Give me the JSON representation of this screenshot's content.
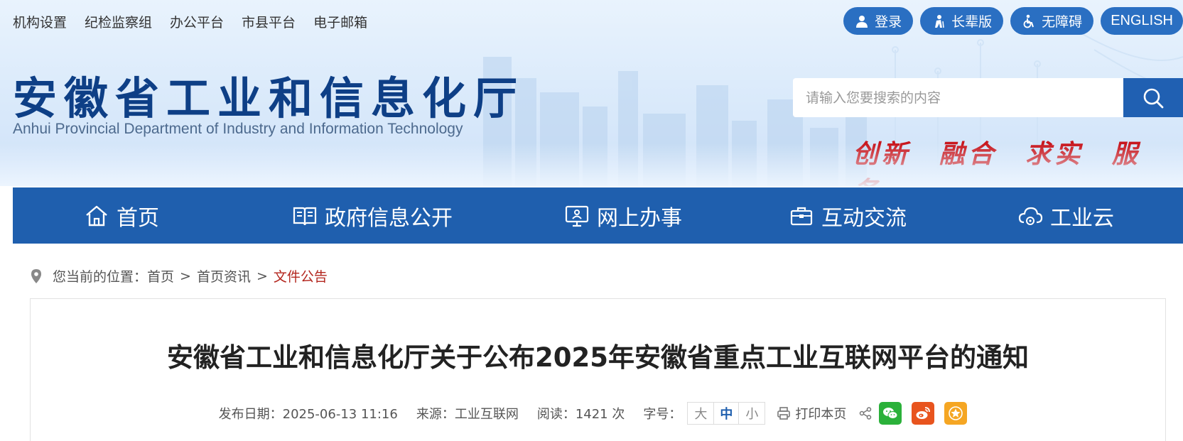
{
  "top_links": [
    "机构设置",
    "纪检监察组",
    "办公平台",
    "市县平台",
    "电子邮箱"
  ],
  "top_buttons": {
    "login": "登录",
    "elder": "长辈版",
    "accessible": "无障碍",
    "english": "ENGLISH"
  },
  "logo": {
    "cn": "安徽省工业和信息化厅",
    "en": "Anhui Provincial Department of Industry and Information Technology"
  },
  "search": {
    "placeholder": "请输入您要搜索的内容"
  },
  "slogan": [
    "创新",
    "融合",
    "求实",
    "服务"
  ],
  "nav": {
    "home": "首页",
    "gov_info": "政府信息公开",
    "online": "网上办事",
    "interact": "互动交流",
    "cloud": "工业云"
  },
  "breadcrumb": {
    "prefix": "您当前的位置：",
    "items": [
      "首页",
      "首页资讯"
    ],
    "separator": ">",
    "current": "文件公告"
  },
  "article": {
    "title": "安徽省工业和信息化厅关于公布2025年安徽省重点工业互联网平台的通知",
    "date": "发布日期：2025-06-13 11:16",
    "source": "来源：工业互联网",
    "reads": "阅读：1421 次",
    "font_label": "字号：",
    "font_sizes": [
      "大",
      "中",
      "小"
    ],
    "print": "打印本页"
  },
  "colors": {
    "primary": "#1f5fae",
    "pill": "#2a6fc2",
    "slogan": "#c8161d",
    "crumb_current": "#b3261e"
  }
}
